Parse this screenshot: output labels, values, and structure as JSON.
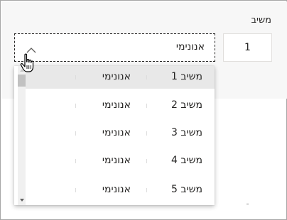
{
  "field": {
    "label": "משיב",
    "index_value": "1"
  },
  "combo": {
    "value": "אנונימי",
    "state": "expanded"
  },
  "dropdown": {
    "selected_index": 0,
    "options": [
      {
        "name": "משיב 1",
        "value": "אנונימי"
      },
      {
        "name": "משיב 2",
        "value": "אנונימי"
      },
      {
        "name": "משיב 3",
        "value": "אנונימי"
      },
      {
        "name": "משיב 4",
        "value": "אנונימי"
      },
      {
        "name": "משיב 5",
        "value": "אנונימי"
      }
    ]
  },
  "icons": {
    "chevron": "chevron-up-icon",
    "cursor": "hand-pointer-icon"
  },
  "colors": {
    "selected_row": "#e8e8e8",
    "band": "#f7f7f7",
    "text": "#252423"
  }
}
